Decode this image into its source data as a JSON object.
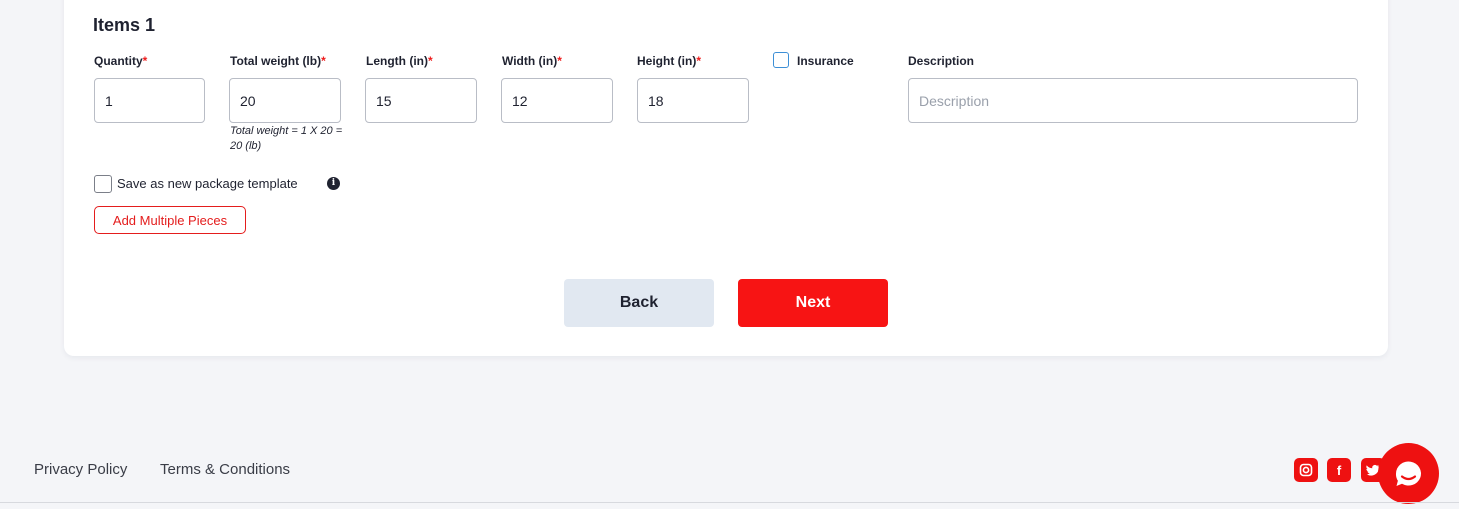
{
  "item_section": {
    "title": "Items 1",
    "fields": {
      "quantity": {
        "label": "Quantity",
        "required_mark": "*",
        "value": "1"
      },
      "total_weight": {
        "label": "Total weight (lb)",
        "required_mark": "*",
        "value": "20"
      },
      "length": {
        "label": "Length (in)",
        "required_mark": "*",
        "value": "15"
      },
      "width": {
        "label": "Width (in)",
        "required_mark": "*",
        "value": "12"
      },
      "height": {
        "label": "Height (in)",
        "required_mark": "*",
        "value": "18"
      },
      "insurance": {
        "label": "Insurance",
        "checked": false
      },
      "description": {
        "label": "Description",
        "value": "",
        "placeholder": "Description"
      }
    },
    "weight_note": "Total weight = 1 X 20 = 20 (lb)",
    "save_template": {
      "label": "Save as new package template",
      "checked": false,
      "info_icon": "info-icon"
    },
    "add_multiple_label": "Add Multiple Pieces"
  },
  "actions": {
    "back_label": "Back",
    "next_label": "Next"
  },
  "footer": {
    "links": [
      "Privacy Policy",
      "Terms & Conditions"
    ],
    "social_icons": [
      "instagram-icon",
      "facebook-icon",
      "twitter-icon"
    ],
    "facebook_glyph": "f",
    "chat_icon": "chat-bubble-icon"
  },
  "colors": {
    "accent": "#f71414",
    "required": "#ee1c1c",
    "back_button_bg": "#e1e8f1",
    "insurance_checkbox_border": "#3d8fd6"
  }
}
